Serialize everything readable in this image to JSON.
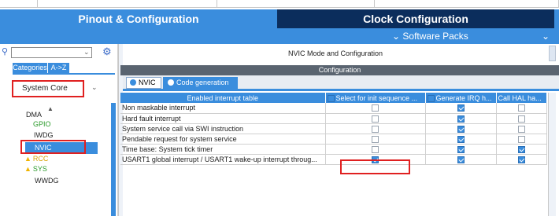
{
  "tabs": {
    "pinout": "Pinout & Configuration",
    "clock": "Clock Configuration"
  },
  "software_packs": {
    "label": "Software Packs",
    "chevron": "chevron-down-icon"
  },
  "sidebar": {
    "search_placeholder": "",
    "categories_label": "Categories",
    "az_label": "A->Z",
    "group_selected": "System Core",
    "items": [
      {
        "label": "DMA",
        "status": "normal",
        "color": "#222222"
      },
      {
        "label": "GPIO",
        "status": "ok",
        "color": "#2a9a2a"
      },
      {
        "label": "IWDG",
        "status": "normal",
        "color": "#222222"
      },
      {
        "label": "NVIC",
        "status": "selected",
        "color": "#ffffff"
      },
      {
        "label": "RCC",
        "status": "warning",
        "color": "#d8a000"
      },
      {
        "label": "SYS",
        "status": "warning",
        "color": "#2a9a2a"
      },
      {
        "label": "WWDG",
        "status": "normal",
        "color": "#222222"
      }
    ]
  },
  "main": {
    "mode_title": "NVIC Mode and Configuration",
    "config_title": "Configuration",
    "subtabs": [
      "NVIC",
      "Code generation"
    ],
    "table": {
      "headers": [
        "Enabled interrupt table",
        "Select for init sequence ...",
        "Generate IRQ h...",
        "Call HAL ha..."
      ],
      "header_checks": [
        true,
        true,
        false
      ],
      "rows": [
        {
          "name": "Non maskable interrupt",
          "select_init": false,
          "gen_irq": true,
          "call_hal": false
        },
        {
          "name": "Hard fault interrupt",
          "select_init": false,
          "gen_irq": true,
          "call_hal": false
        },
        {
          "name": "System service call via SWI instruction",
          "select_init": false,
          "gen_irq": true,
          "call_hal": false
        },
        {
          "name": "Pendable request for system service",
          "select_init": false,
          "gen_irq": true,
          "call_hal": false
        },
        {
          "name": "Time base: System tick timer",
          "select_init": false,
          "gen_irq": true,
          "call_hal": true
        },
        {
          "name": "USART1 global interrupt / USART1 wake-up interrupt throug...",
          "select_init": true,
          "gen_irq": true,
          "call_hal": true
        }
      ]
    }
  },
  "colors": {
    "accent": "#3a8ddd",
    "dark_tab": "#0b2d5c",
    "highlight": "#e02020"
  }
}
